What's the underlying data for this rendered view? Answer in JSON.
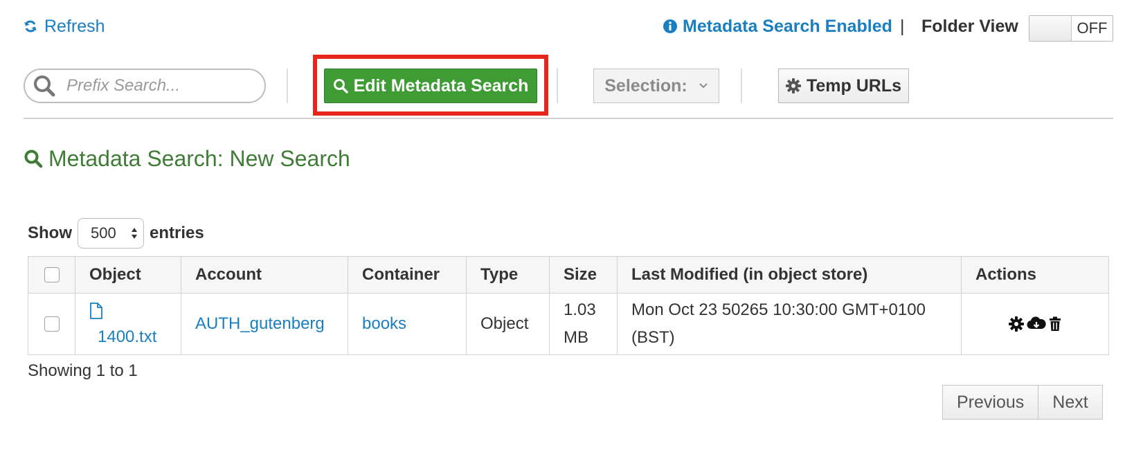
{
  "header": {
    "refresh_label": "Refresh",
    "metadata_status": "Metadata Search Enabled",
    "separator": "|",
    "folder_view_label": "Folder View",
    "folder_view_state": "OFF"
  },
  "toolbar": {
    "prefix_placeholder": "Prefix Search...",
    "edit_metadata_label": "Edit Metadata Search",
    "selection_label": "Selection:",
    "temp_urls_label": "Temp URLs"
  },
  "search": {
    "title": "Metadata Search: New Search"
  },
  "table": {
    "show_label": "Show",
    "entries_value": "500",
    "entries_label": "entries",
    "columns": [
      "Object",
      "Account",
      "Container",
      "Type",
      "Size",
      "Last Modified (in object store)",
      "Actions"
    ],
    "rows": [
      {
        "object": "1400.txt",
        "account": "AUTH_gutenberg",
        "container": "books",
        "type": "Object",
        "size": "1.03 MB",
        "last_modified": "Mon Oct 23 50265 10:30:00 GMT+0100 (BST)"
      }
    ],
    "showing_text": "Showing 1 to 1",
    "previous_label": "Previous",
    "next_label": "Next"
  },
  "colors": {
    "link": "#1a7fc1",
    "primary_button": "#3f9c35",
    "heading": "#3f7c35",
    "highlight_box": "#e8251b"
  },
  "icons": [
    "refresh-icon",
    "info-icon",
    "search-icon",
    "gear-icon",
    "chevron-down-icon",
    "file-icon",
    "cloud-download-icon",
    "trash-icon"
  ]
}
